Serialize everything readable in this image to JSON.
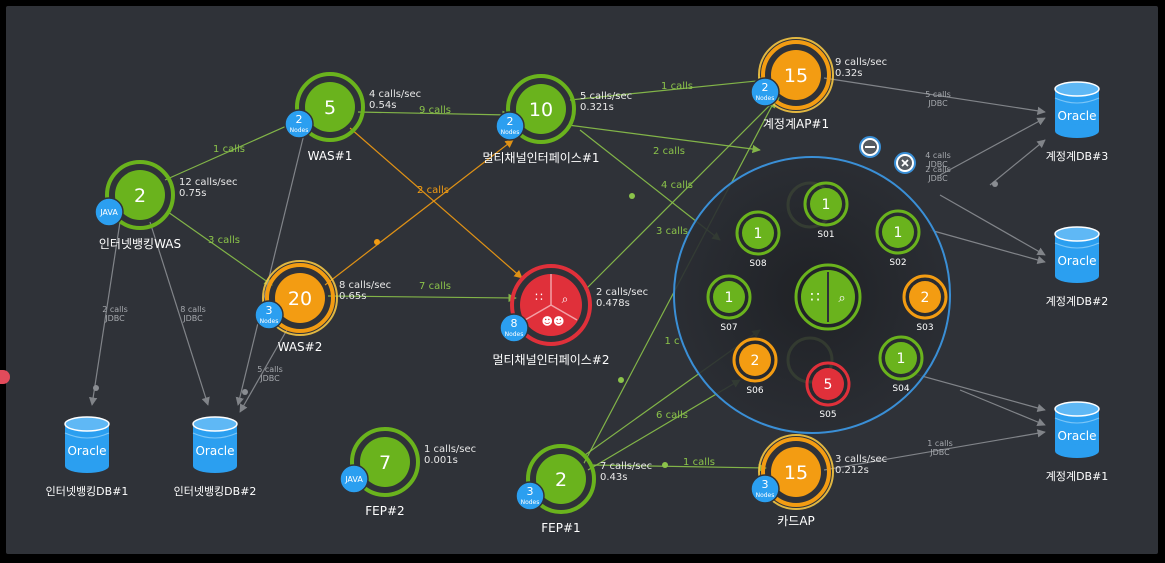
{
  "colors": {
    "background": "#2f3238",
    "green": "#6ab31d",
    "orange": "#f39c12",
    "red": "#e0303a",
    "blue": "#2b9ff0",
    "edge_green": "#8bc34a",
    "edge_orange": "#f39c12",
    "edge_gray": "#8a8d92",
    "magnifier_border": "#3a8fd6"
  },
  "nodes": [
    {
      "id": "ibwas",
      "count": "2",
      "badge": "JAVA",
      "name": "인터넷뱅킹WAS",
      "rate": "12 calls/sec",
      "time": "0.75s",
      "color": "green"
    },
    {
      "id": "was1",
      "count": "5",
      "badge": "2",
      "badge2": "Nodes",
      "name": "WAS#1",
      "rate": "4 calls/sec",
      "time": "0.54s",
      "color": "green"
    },
    {
      "id": "was2",
      "count": "20",
      "badge": "3",
      "badge2": "Nodes",
      "name": "WAS#2",
      "rate": "8 calls/sec",
      "time": "0.65s",
      "color": "orange"
    },
    {
      "id": "mci1",
      "count": "10",
      "badge": "2",
      "badge2": "Nodes",
      "name": "멀티채널인터페이스#1",
      "rate": "5 calls/sec",
      "time": "0.321s",
      "color": "green"
    },
    {
      "id": "mci2",
      "count": "",
      "badge": "8",
      "badge2": "Nodes",
      "name": "멀티채널인터페이스#2",
      "rate": "2 calls/sec",
      "time": "0.478s",
      "color": "red"
    },
    {
      "id": "acct",
      "count": "15",
      "badge": "2",
      "badge2": "Nodes",
      "name": "계정계AP#1",
      "rate": "9 calls/sec",
      "time": "0.32s",
      "color": "orange"
    },
    {
      "id": "fep2",
      "count": "7",
      "badge": "JAVA",
      "name": "FEP#2",
      "rate": "1 calls/sec",
      "time": "0.001s",
      "color": "green"
    },
    {
      "id": "fep1",
      "count": "2",
      "badge": "3",
      "badge2": "Nodes",
      "name": "FEP#1",
      "rate": "7 calls/sec",
      "time": "0.43s",
      "color": "green"
    },
    {
      "id": "card",
      "count": "15",
      "badge": "3",
      "badge2": "Nodes",
      "name": "카드AP",
      "rate": "3 calls/sec",
      "time": "0.212s",
      "color": "orange"
    }
  ],
  "databases": [
    {
      "id": "db_ib1",
      "label": "Oracle",
      "name": "인터넷뱅킹DB#1"
    },
    {
      "id": "db_ib2",
      "label": "Oracle",
      "name": "인터넷뱅킹DB#2"
    },
    {
      "id": "db_acc3",
      "label": "Oracle",
      "name": "계정계DB#3"
    },
    {
      "id": "db_acc2",
      "label": "Oracle",
      "name": "계정계DB#2"
    },
    {
      "id": "db_acc1",
      "label": "Oracle",
      "name": "계정계DB#1"
    }
  ],
  "edge_labels": [
    {
      "id": "e1",
      "text": "1 calls",
      "color": "green"
    },
    {
      "id": "e2",
      "text": "9 calls",
      "color": "green"
    },
    {
      "id": "e3",
      "text": "1 calls",
      "color": "green"
    },
    {
      "id": "e4",
      "text": "2 calls",
      "color": "orange"
    },
    {
      "id": "e5",
      "text": "3 calls",
      "color": "green"
    },
    {
      "id": "e6",
      "text": "7 calls",
      "color": "green"
    },
    {
      "id": "e7",
      "text": "2 calls",
      "color": "green"
    },
    {
      "id": "e8",
      "text": "4 calls",
      "color": "green"
    },
    {
      "id": "e9",
      "text": "3 calls",
      "color": "green"
    },
    {
      "id": "e10",
      "text": "6 calls",
      "color": "green"
    },
    {
      "id": "e11",
      "text": "1 calls",
      "color": "green"
    },
    {
      "id": "e12",
      "text": "1 c",
      "color": "green"
    }
  ],
  "jdbc_labels": [
    {
      "id": "j1",
      "line1": "2 calls",
      "line2": "JDBC"
    },
    {
      "id": "j2",
      "line1": "8 calls",
      "line2": "JDBC"
    },
    {
      "id": "j3",
      "line1": "5 calls",
      "line2": "JDBC"
    },
    {
      "id": "j4",
      "line1": "5 calls",
      "line2": "JDBC"
    },
    {
      "id": "j5",
      "line1": "4 calls",
      "line2": "JDBC"
    },
    {
      "id": "j6",
      "line1": "2 calls",
      "line2": "JDBC"
    },
    {
      "id": "j7",
      "line1": "1 calls",
      "line2": "JDBC"
    }
  ],
  "magnifier": {
    "servers": [
      {
        "id": "S01",
        "count": "1",
        "color": "green"
      },
      {
        "id": "S02",
        "count": "1",
        "color": "green"
      },
      {
        "id": "S03",
        "count": "2",
        "color": "orange"
      },
      {
        "id": "S04",
        "count": "1",
        "color": "green"
      },
      {
        "id": "S05",
        "count": "5",
        "color": "red"
      },
      {
        "id": "S06",
        "count": "2",
        "color": "orange"
      },
      {
        "id": "S07",
        "count": "1",
        "color": "green"
      },
      {
        "id": "S08",
        "count": "1",
        "color": "green"
      }
    ],
    "collapse_icon": "minus-icon",
    "close_icon": "close-icon",
    "center_icons": [
      "topology-icon",
      "search-icon"
    ]
  }
}
